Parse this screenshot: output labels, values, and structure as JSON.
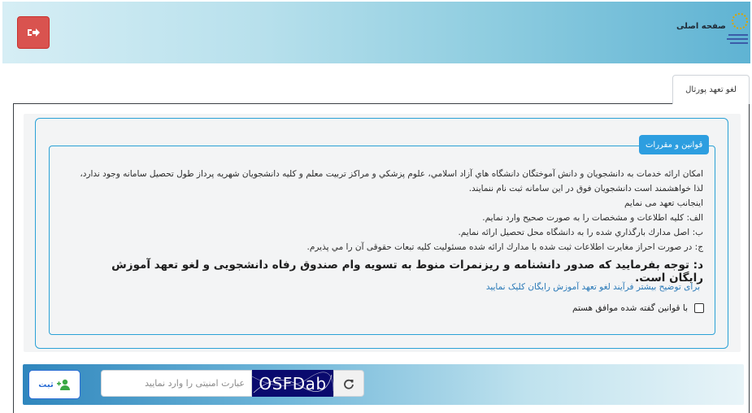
{
  "header": {
    "home_label": "صفحه اصلی",
    "logout_icon": "sign-out-icon",
    "logo_icon": "university-logo-icon"
  },
  "tabs": [
    {
      "label": "لغو تعهد پورتال"
    }
  ],
  "rules": {
    "legend": "قوانین و مقررات",
    "paragraphs": [
      "امکان ارائه خدمات به دانشجویان و دانش آموختگان دانشگاه هاي آزاد اسلامي، علوم پزشکي و مراکز تربیت معلم و کلیه دانشجویان شهریه پرداز طول تحصیل سامانه وجود ندارد، لذا خواهشمند است دانشجویان فوق در این سامانه ثبت نام ننمایند.",
      "اینجانب تعهد می نمایم",
      "الف: کلیه اطلاعات و مشخصات را به صورت صحیح وارد نمایم.",
      "ب: اصل مدارك بارگذاري شده را به دانشگاه محل تحصیل ارائه نمایم.",
      "ج: در صورت احراز مغایرت اطلاعات ثبت شده با مدارك ارائه شده مسئولیت كلیه تبعات حقوقی آن را مي پذیرم."
    ],
    "notice": "د: توجه بفرمایید که صدور دانشنامه و ریزنمرات منوط به تسویه وام صندوق رفاه دانشجویی و لغو تعهد آموزش رایگان است.",
    "info_link": "برای توضیح بیشتر فرآیند لغو تعهد آموزش رایگان کلیک نمایید",
    "agree_label": "با قوانین گفته شده موافق هستم",
    "agree_checked": false
  },
  "footer": {
    "register_label": "ثبت",
    "register_icon": "user-plus-icon",
    "captcha_placeholder": "عبارت امنیتی را وارد نمایید",
    "captcha_value": "",
    "captcha_text": "OSFDab",
    "refresh_icon": "refresh-icon"
  },
  "colors": {
    "logout_red": "#d9534f",
    "accent_blue": "#2d9ee0",
    "border_blue": "#2aa1d6",
    "link_blue": "#2b7ab8",
    "register_blue": "#2c6ed5",
    "captcha_bg": "#0a0a6e"
  }
}
